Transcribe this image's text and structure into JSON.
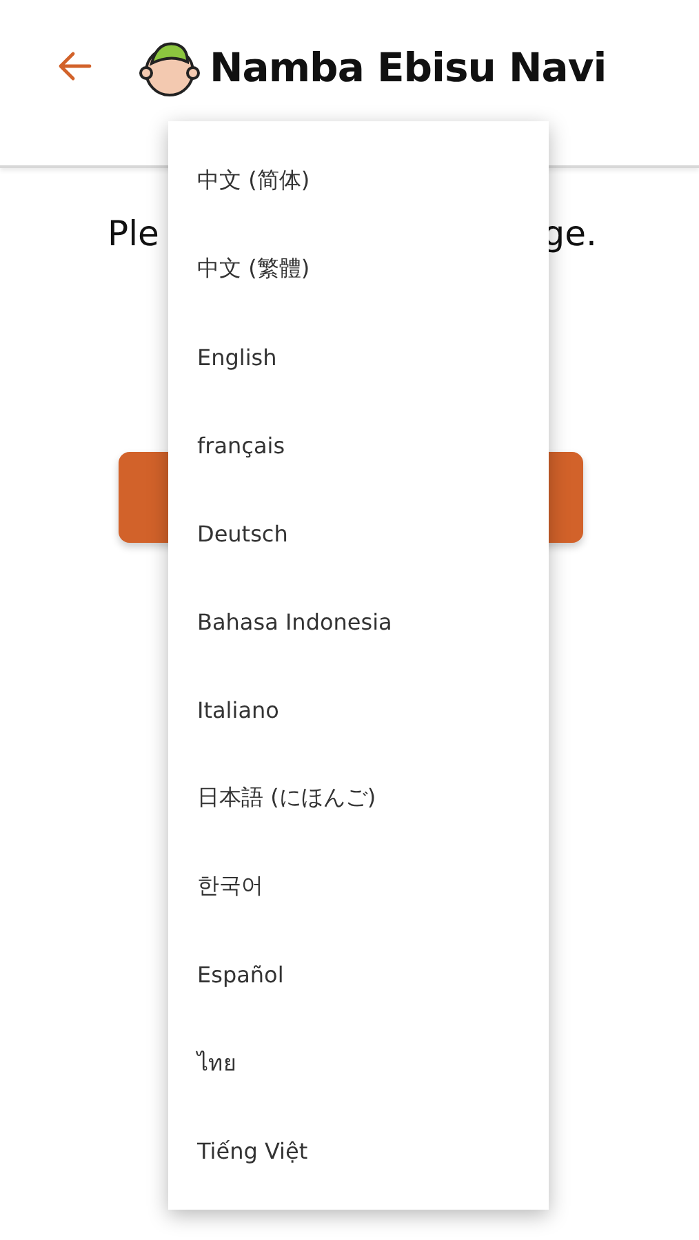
{
  "header": {
    "title": "Namba Ebisu Navi"
  },
  "prompt": {
    "left": "Ple",
    "right": "ge."
  },
  "menu": {
    "items": [
      {
        "label": "中文 (简体)"
      },
      {
        "label": "中文 (繁體)"
      },
      {
        "label": "English"
      },
      {
        "label": "français"
      },
      {
        "label": "Deutsch"
      },
      {
        "label": "Bahasa Indonesia"
      },
      {
        "label": "Italiano"
      },
      {
        "label": "日本語 (にほんご)"
      },
      {
        "label": "한국어"
      },
      {
        "label": "Español"
      },
      {
        "label": "ไทย"
      },
      {
        "label": "Tiếng Việt"
      }
    ]
  }
}
